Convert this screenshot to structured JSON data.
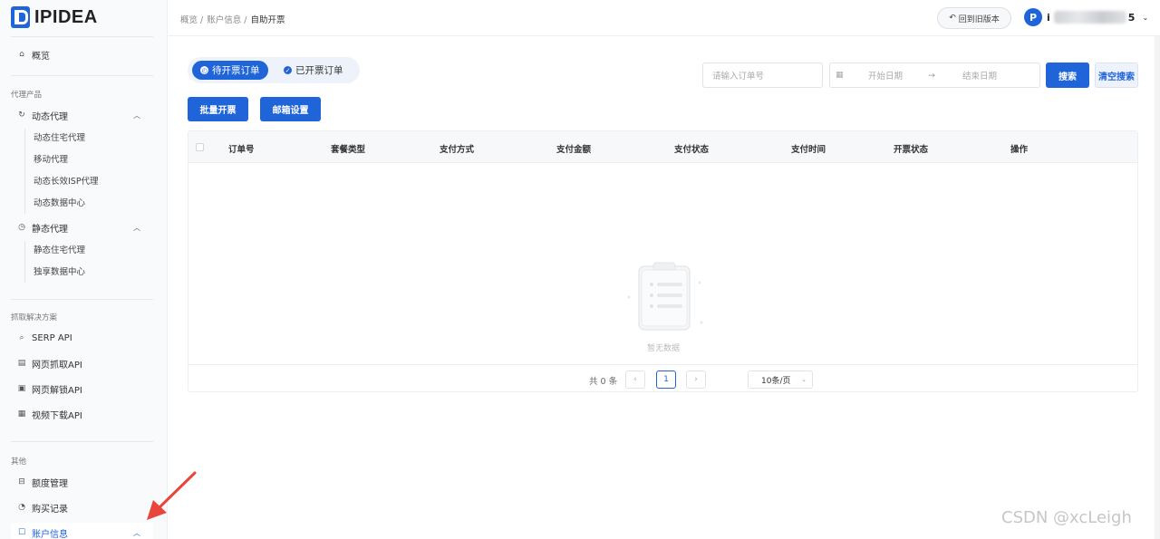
{
  "brand": {
    "name": "IPIDEA"
  },
  "breadcrumb": {
    "items": [
      "概览 /",
      "账户信息 /"
    ],
    "current": "自助开票"
  },
  "header": {
    "old_version": "回到旧版本",
    "user_prefix": "i",
    "user_suffix": "5"
  },
  "sidebar": {
    "overview": "概览",
    "sections": {
      "proxy": "代理产品",
      "scrape": "抓取解决方案",
      "other": "其他"
    },
    "dynamic": {
      "label": "动态代理",
      "items": [
        "动态住宅代理",
        "移动代理",
        "动态长效ISP代理",
        "动态数据中心"
      ]
    },
    "static": {
      "label": "静态代理",
      "items": [
        "静态住宅代理",
        "独享数据中心"
      ]
    },
    "scrape_items": [
      "SERP API",
      "网页抓取API",
      "网页解锁API",
      "视频下载API"
    ],
    "other_items": [
      "额度管理",
      "购买记录",
      "账户信息"
    ]
  },
  "tabs": {
    "pending": "待开票订单",
    "done": "已开票订单"
  },
  "filters": {
    "order_placeholder": "请输入订单号",
    "start_date": "开始日期",
    "date_sep": "→",
    "end_date": "结束日期",
    "search": "搜索",
    "clear": "清空搜索"
  },
  "actions": {
    "batch": "批量开票",
    "mail": "邮箱设置"
  },
  "table": {
    "columns": [
      "订单号",
      "套餐类型",
      "支付方式",
      "支付金额",
      "支付状态",
      "支付时间",
      "开票状态",
      "操作"
    ],
    "empty_text": "暂无数据"
  },
  "pagination": {
    "total": "共 0 条",
    "prev": "‹",
    "current": "1",
    "next": "›",
    "page_size": "10条/页"
  },
  "watermark": "CSDN @xcLeigh",
  "colors": {
    "primary": "#1f64d8",
    "annotation_arrow": "#e8453c"
  }
}
